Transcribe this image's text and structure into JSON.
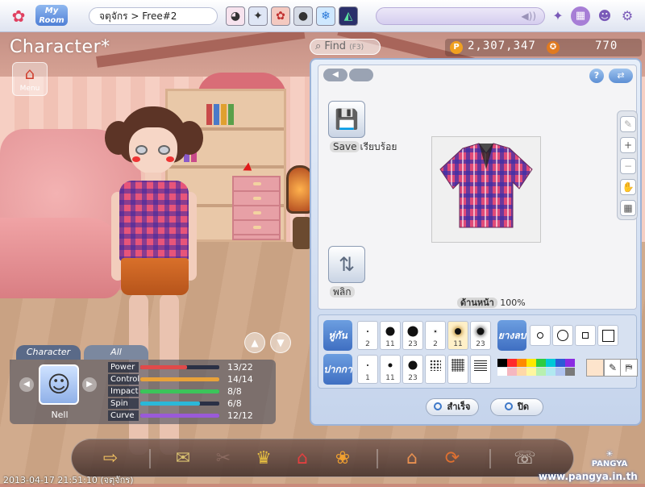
{
  "topbar": {
    "app_logo": "pangya-logo-icon",
    "myroom_label": "My Room",
    "breadcrumb": "จตุจักร > Free#2",
    "avatar_slots": [
      "◕",
      "✦",
      "✿",
      "●",
      "❄",
      "◭"
    ],
    "right_icons": [
      "sparkle-icon",
      "grid-menu-icon",
      "skull-icon",
      "gear-icon"
    ]
  },
  "screen": {
    "title": "Character",
    "title_mark": "*",
    "menu_label": "Menu"
  },
  "search": {
    "label": "Find",
    "shortcut": "(F3)"
  },
  "currency": {
    "pang_icon_label": "P",
    "pang": "2,307,347",
    "cookie": "770"
  },
  "editor": {
    "nav_prev": "◀",
    "help_label": "?",
    "swap_label": "⇄",
    "save_label": "Save",
    "save_status": "เรียบร้อย",
    "flip_label": "พลิก",
    "view_label": "ด้านหน้า",
    "zoom": "100%",
    "side_tools": [
      "eraser-icon",
      "zoom-in-icon",
      "zoom-out-icon",
      "hand-icon",
      "grid-icon"
    ],
    "brush_row_label": "หู่กัน",
    "brushes": [
      {
        "size": 2,
        "num": "2",
        "selected": false
      },
      {
        "size": 11,
        "num": "11",
        "selected": false
      },
      {
        "size": 13,
        "num": "23",
        "selected": false
      },
      {
        "size": 2,
        "num": "2",
        "selected": false
      },
      {
        "size": 8,
        "num": "11",
        "selected": true
      },
      {
        "size": 9,
        "num": "23",
        "selected": false
      }
    ],
    "eraser_row_label": "ยางลบ",
    "shapes": [
      "circle-small",
      "circle-large",
      "square-small",
      "square-large"
    ],
    "pen_row_label": "ปากกา",
    "pens": [
      {
        "num": "1"
      },
      {
        "num": "11"
      },
      {
        "num": "23"
      },
      {
        "num": ""
      },
      {
        "num": ""
      },
      {
        "num": ""
      }
    ],
    "colors": [
      "#000000",
      "#ff2b2b",
      "#ff8a00",
      "#ffe800",
      "#2ecc40",
      "#00c8d7",
      "#2d5bd6",
      "#8a2be2",
      "#ffffff",
      "#f5b7c0",
      "#ffd8a8",
      "#fff6a0",
      "#b8f0b0",
      "#b0e8f0",
      "#b0c4f0",
      "#7a7a7a"
    ],
    "current_color": "#fde4cc",
    "confirm_label": "สำเร็จ",
    "close_label": "ปิด"
  },
  "stats": {
    "tab_character": "Character",
    "tab_all": "All",
    "character_name": "Nell",
    "rows": [
      {
        "label": "Power",
        "value": "13/22",
        "fill": 0.59,
        "color": "#e04a4a"
      },
      {
        "label": "Control",
        "value": "14/14",
        "fill": 1.0,
        "color": "#e8a23a"
      },
      {
        "label": "Impact",
        "value": "8/8",
        "fill": 1.0,
        "color": "#3cc45a"
      },
      {
        "label": "Spin",
        "value": "6/8",
        "fill": 0.75,
        "color": "#2bb8d8"
      },
      {
        "label": "Curve",
        "value": "12/12",
        "fill": 1.0,
        "color": "#9a5ad8"
      }
    ]
  },
  "bottombar": {
    "icons": [
      "exit-door-icon",
      "scroll-icon",
      "unknown-dim-icon",
      "trophy-icon",
      "shop-icon",
      "gift-icon",
      "home-icon",
      "refresh-icon",
      "phone-icon"
    ]
  },
  "footer": {
    "timestamp": "2013-04-17 21:51:10 (จตุจักร)",
    "brand": "PANGYA",
    "website": "www.pangya.in.th"
  }
}
